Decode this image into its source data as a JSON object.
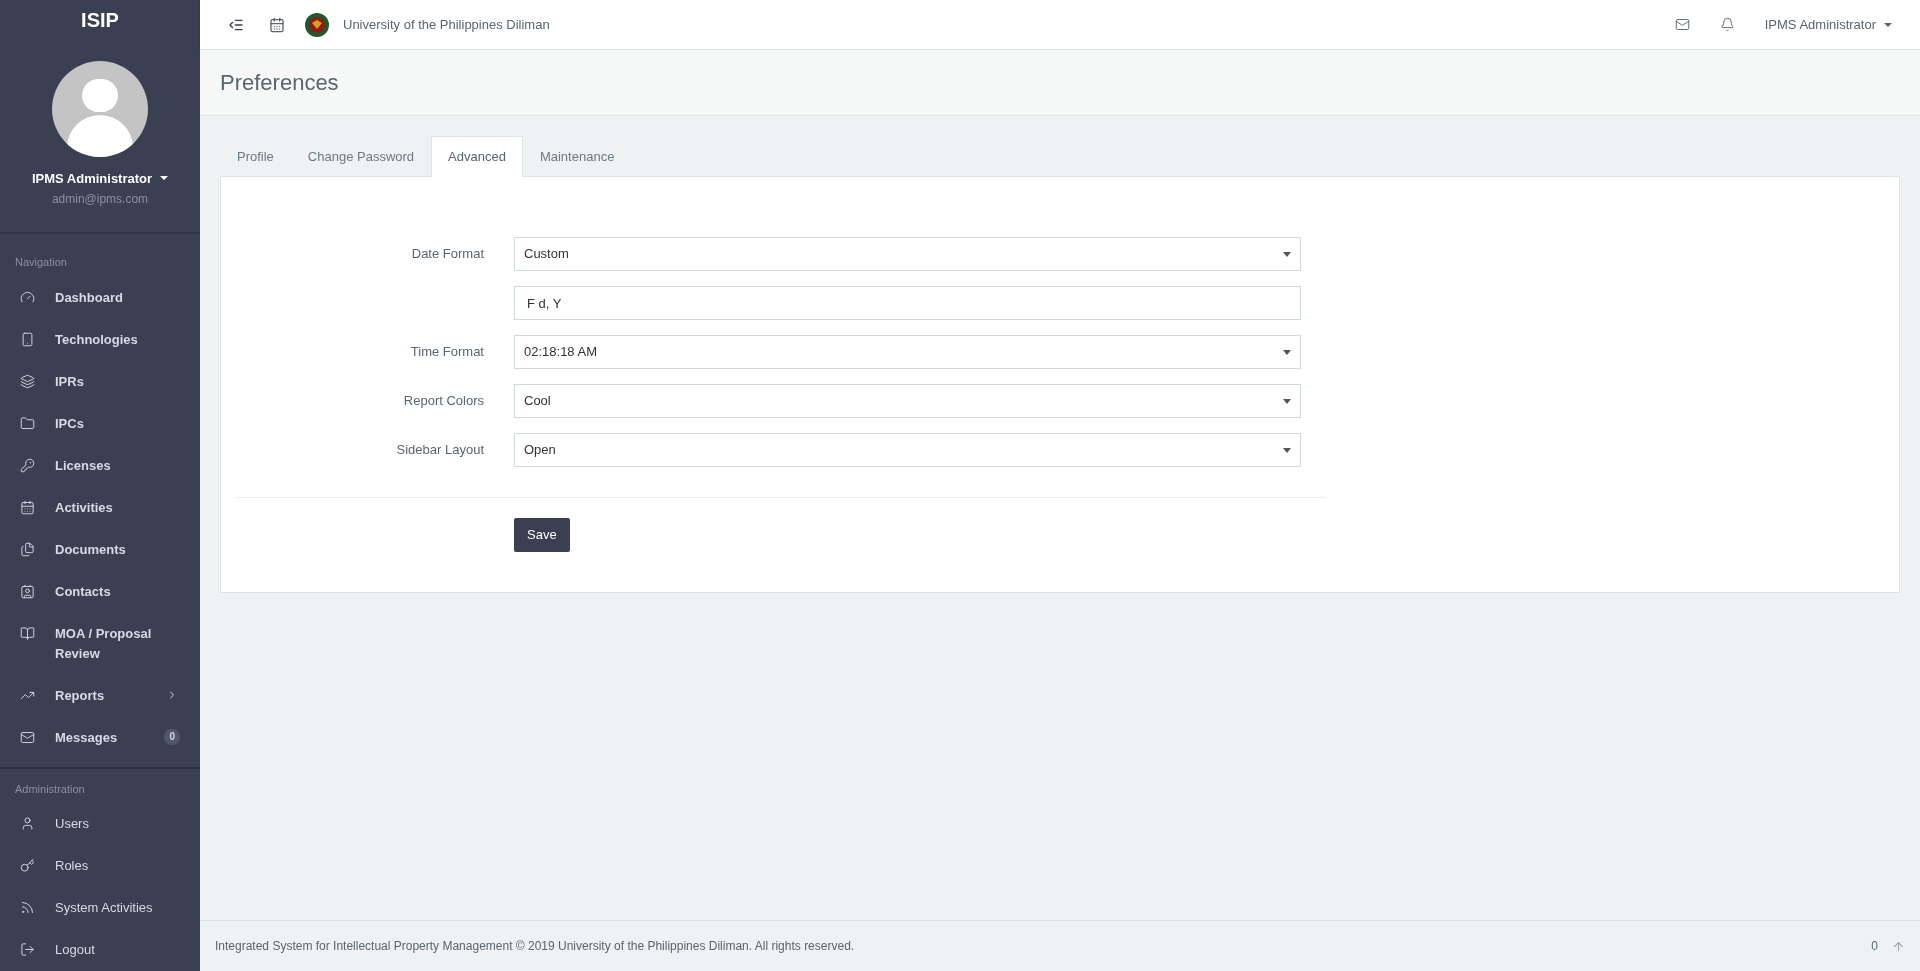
{
  "sidebar": {
    "brand": "ISIP",
    "user": {
      "name": "IPMS Administrator",
      "email": "admin@ipms.com"
    },
    "sections": [
      {
        "title": "Navigation",
        "items": [
          {
            "label": "Dashboard"
          },
          {
            "label": "Technologies"
          },
          {
            "label": "IPRs"
          },
          {
            "label": "IPCs"
          },
          {
            "label": "Licenses"
          },
          {
            "label": "Activities"
          },
          {
            "label": "Documents"
          },
          {
            "label": "Contacts"
          },
          {
            "label": "MOA / Proposal Review"
          },
          {
            "label": "Reports",
            "expandable": true
          },
          {
            "label": "Messages",
            "badge": "0"
          }
        ]
      },
      {
        "title": "Administration",
        "items": [
          {
            "label": "Users"
          },
          {
            "label": "Roles"
          },
          {
            "label": "System Activities"
          },
          {
            "label": "Logout"
          }
        ]
      }
    ]
  },
  "topbar": {
    "institution": "University of the Philippines Diliman",
    "user": "IPMS Administrator"
  },
  "page_title": "Preferences",
  "tabs": [
    {
      "label": "Profile",
      "selected": false
    },
    {
      "label": "Change Password",
      "selected": false
    },
    {
      "label": "Advanced",
      "selected": true
    },
    {
      "label": "Maintenance",
      "selected": false
    }
  ],
  "form": {
    "rows": [
      {
        "kind": "select",
        "label": "Date Format",
        "value": "Custom"
      },
      {
        "kind": "text",
        "value": "F d, Y"
      },
      {
        "kind": "select",
        "label": "Time Format",
        "value": "02:18:18 AM"
      },
      {
        "kind": "select",
        "label": "Report Colors",
        "value": "Cool"
      },
      {
        "kind": "select",
        "label": "Sidebar Layout",
        "value": "Open"
      }
    ],
    "button": "Save"
  },
  "footer": {
    "text": "Integrated System for Intellectual Property Management © 2019 University of the Philippines Diliman. All rights reserved.",
    "counter": "0"
  }
}
